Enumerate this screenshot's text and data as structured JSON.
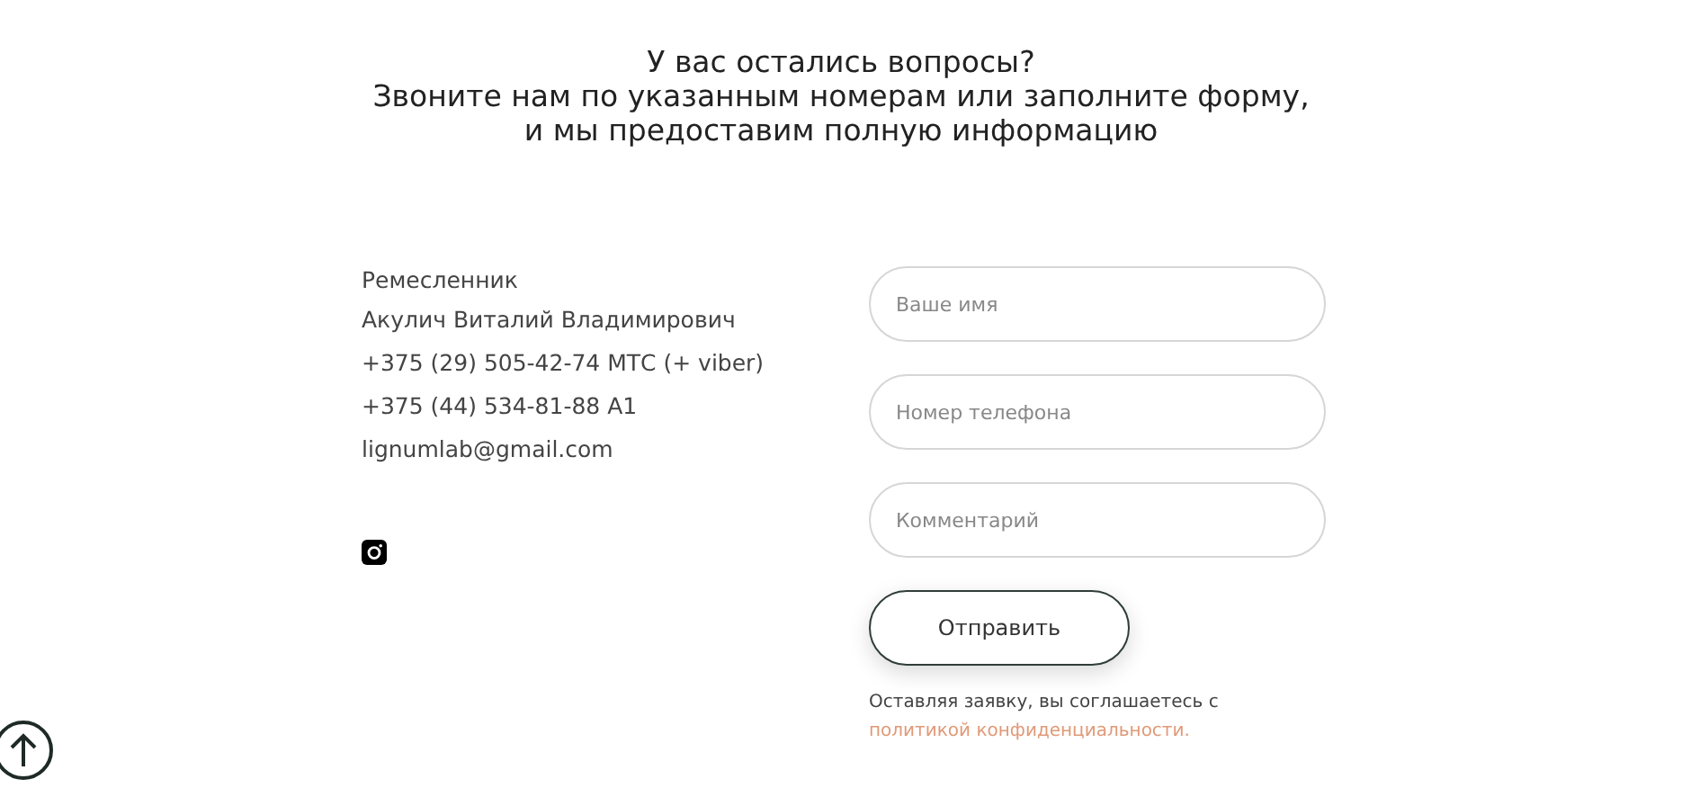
{
  "heading": [
    "У вас остались вопросы?",
    "Звоните нам по указанным номерам или заполните форму,",
    "и мы предоставим полную информацию"
  ],
  "contacts": {
    "lines": [
      "Ремесленник",
      "Акулич Виталий Владимирович",
      "+375 (29) 505-42-74 МТС (+ viber)",
      "+375 (44) 534-81-88 А1",
      "lignumlab@gmail.com"
    ]
  },
  "form": {
    "fields": [
      {
        "placeholder": "Ваше имя"
      },
      {
        "placeholder": "Номер телефона"
      },
      {
        "placeholder": "Комментарий"
      }
    ],
    "submit": "Отправить",
    "consent": {
      "text": "Оставляя заявку, вы соглашаетесь с ",
      "link": "политикой конфиденциальности."
    }
  }
}
